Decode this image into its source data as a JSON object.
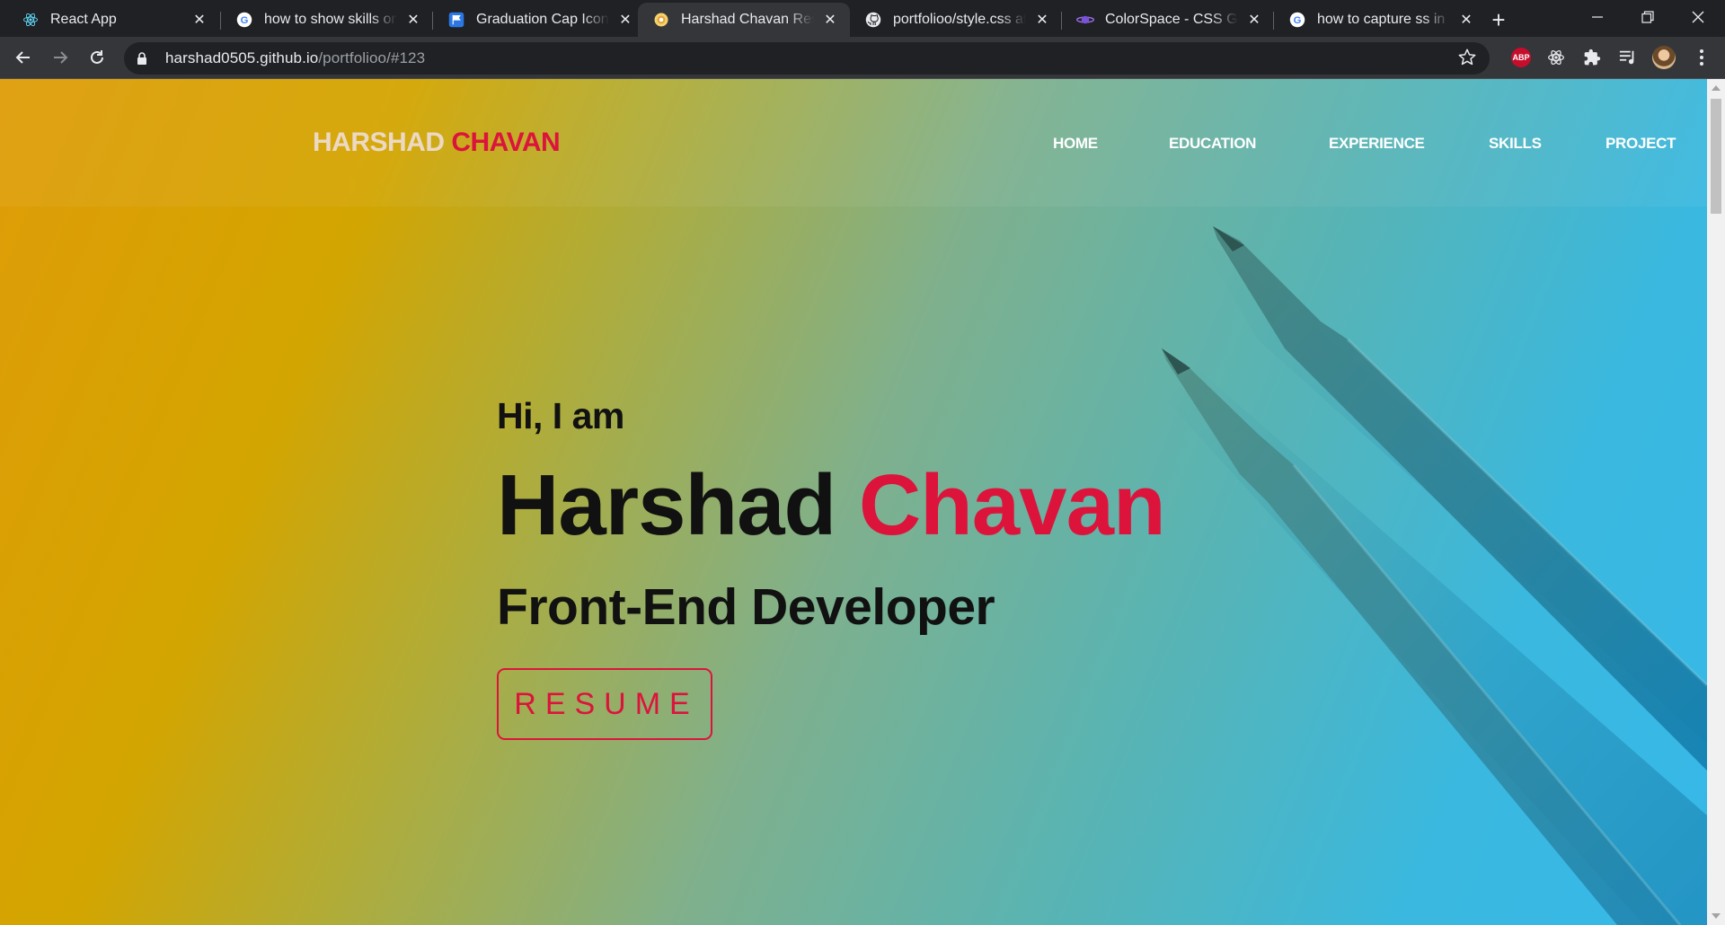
{
  "browser": {
    "tabs": [
      {
        "title": "React App",
        "icon": "react-icon"
      },
      {
        "title": "how to show skills on w",
        "icon": "google-icon"
      },
      {
        "title": "Graduation Cap Icon | F",
        "icon": "flag-icon"
      },
      {
        "title": "Harshad Chavan Resum",
        "icon": "site-favicon",
        "active": true
      },
      {
        "title": "portfolioo/style.css at m",
        "icon": "github-icon"
      },
      {
        "title": "ColorSpace - CSS Grad",
        "icon": "colorspace-icon"
      },
      {
        "title": "how to capture ss in lap",
        "icon": "google-icon"
      }
    ],
    "url": {
      "host": "harshad0505.github.io",
      "path": "/portfolioo/#123"
    },
    "extensions": {
      "abp_label": "ABP"
    }
  },
  "site": {
    "brand_first": "HARSHAD",
    "brand_last": "CHAVAN",
    "nav": [
      "HOME",
      "EDUCATION",
      "EXPERIENCE",
      "SKILLS",
      "PROJECT"
    ],
    "greeting": "Hi, I am",
    "name_first": "Harshad",
    "name_last": "Chavan",
    "role": "Front-End Developer",
    "resume_label": "RESUME"
  },
  "colors": {
    "accent": "#dc143c",
    "gradient_start": "#df9c08",
    "gradient_end": "#36b8e8",
    "chrome_dark": "#202124"
  }
}
